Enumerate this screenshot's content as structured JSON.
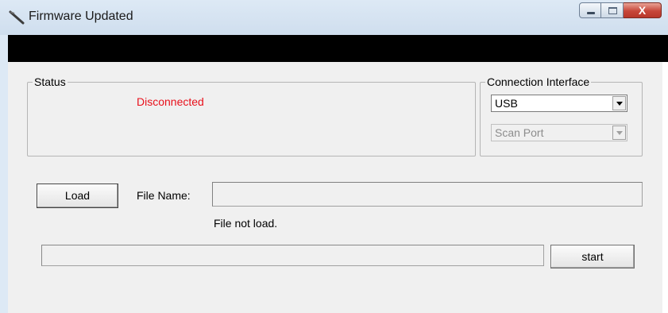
{
  "window": {
    "title": "Firmware Updated",
    "controls": {
      "minimize_icon": "minimize-icon",
      "maximize_icon": "maximize-icon",
      "close_label": "X"
    }
  },
  "status": {
    "group_label": "Status",
    "value": "Disconnected",
    "value_color": "#e8101b"
  },
  "connection": {
    "group_label": "Connection Interface",
    "interface_value": "USB",
    "port_value": "Scan Port"
  },
  "file": {
    "load_label": "Load",
    "file_name_label": "File Name:",
    "file_name_value": "",
    "load_status": "File not load."
  },
  "update": {
    "progress": 0,
    "start_label": "start"
  }
}
